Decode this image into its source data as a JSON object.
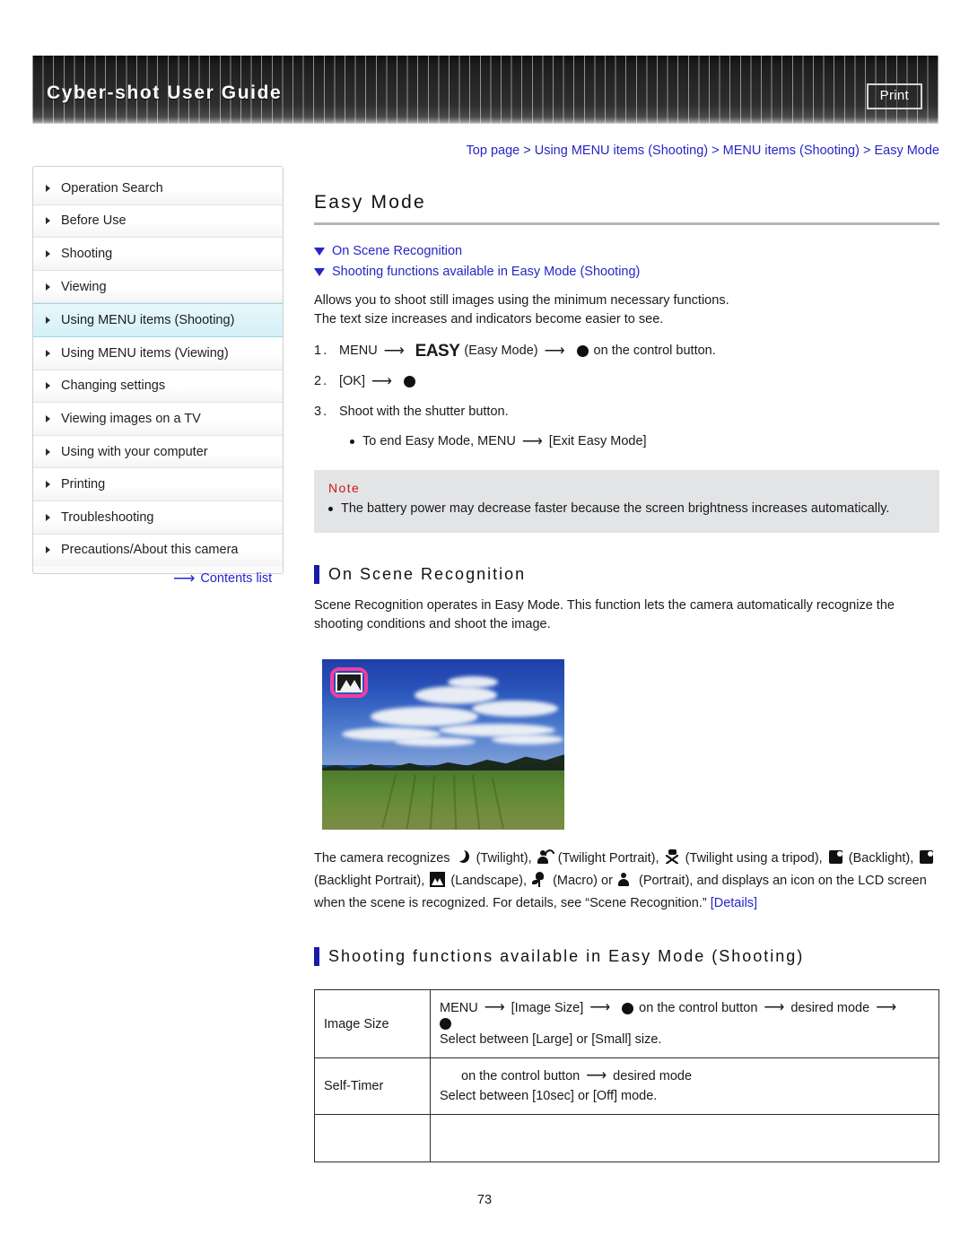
{
  "header": {
    "title": "Cyber-shot User Guide",
    "print_label": "Print"
  },
  "sidebar": {
    "items": [
      {
        "label": "Operation Search",
        "selected": false
      },
      {
        "label": "Before Use",
        "selected": false
      },
      {
        "label": "Shooting",
        "selected": false
      },
      {
        "label": "Viewing",
        "selected": false
      },
      {
        "label": "Using MENU items (Shooting)",
        "selected": true
      },
      {
        "label": "Using MENU items (Viewing)",
        "selected": false
      },
      {
        "label": "Changing settings",
        "selected": false
      },
      {
        "label": "Viewing images on a TV",
        "selected": false
      },
      {
        "label": "Using with your computer",
        "selected": false
      },
      {
        "label": "Printing",
        "selected": false
      },
      {
        "label": "Troubleshooting",
        "selected": false
      },
      {
        "label": "Precautions/About this camera",
        "selected": false
      }
    ],
    "contents_link": "Contents list",
    "contents_arrow": "right-arrow-icon"
  },
  "breadcrumb": "Top page > Using MENU items (Shooting) > MENU items (Shooting) > Easy Mode",
  "page_title": "Easy Mode",
  "anchor_links": [
    "On Scene Recognition",
    "Shooting functions available in Easy Mode (Shooting)"
  ],
  "intro": {
    "line1": "Allows you to shoot still images using the minimum necessary functions.",
    "line2": "The text size increases and indicators become easier to see."
  },
  "steps": {
    "step1": {
      "num": "1.",
      "menu": "MENU",
      "easy_logo": "EASY",
      "easy_caption": "(Easy Mode)",
      "tail": "on the control button."
    },
    "step2": {
      "num": "2.",
      "ok": "[OK]"
    },
    "step3": {
      "num": "3.",
      "text": "Shoot with the shutter button.",
      "sub_prefix": "To end Easy Mode, MENU",
      "sub_tail": "[Exit Easy Mode]"
    }
  },
  "note": {
    "title": "Note",
    "item": "The battery power may decrease faster because the screen brightness increases automatically."
  },
  "scene_section": {
    "heading": "On Scene Recognition",
    "body": "Scene Recognition operates in Easy Mode. This function lets the camera automatically recognize the shooting conditions and shoot the image.",
    "photo_caption_icon": "landscape-scene-icon",
    "paragraph": {
      "p1": "The camera recognizes",
      "twilight": "(Twilight),",
      "twilight_portrait": "(Twilight Portrait),",
      "twilight_tripod": "(Twilight using a tripod),",
      "backlight": "(Backlight),",
      "backlight_portrait": "(Backlight Portrait),",
      "landscape": "(Landscape),",
      "macro": "(Macro) or",
      "portrait": "(Portrait), and displays an icon on the LCD screen when the scene is recognized. For details, see “Scene Recognition.”",
      "details": "[Details]"
    }
  },
  "functions_section": {
    "heading": "Shooting functions available in Easy Mode (Shooting)",
    "rows": [
      {
        "label": "Image Size",
        "line1_a": "MENU",
        "line1_b": "[Image Size]",
        "line1_c": "on the control button",
        "line1_d": "desired mode",
        "line2": "Select between [Large] or [Small] size."
      },
      {
        "label": "Self-Timer",
        "line1_a": "on the control button",
        "line1_b": "desired mode",
        "line2": "Select between [10sec] or [Off] mode."
      }
    ]
  },
  "page_number": "73",
  "colors": {
    "link": "#2626c8",
    "note_red": "#d01616",
    "section_bar": "#1a1aa8",
    "selected_sidebar": "#d5f0f8",
    "badge_pink": "#ef3fa0"
  }
}
